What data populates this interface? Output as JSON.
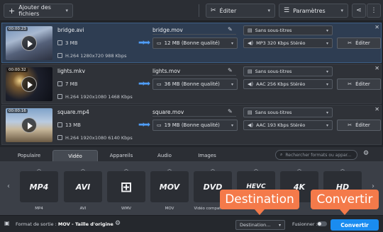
{
  "toolbar": {
    "add_files": "Ajouter des fichiers",
    "edit": "Éditer",
    "settings": "Paramètres"
  },
  "files": [
    {
      "time": "00:00:23",
      "name": "bridge.avi",
      "size": "3 MB",
      "info": "H.264 1280x720 988 Kbps",
      "out_name": "bridge.mov",
      "out_size": "12 MB (Bonne qualité)",
      "subtitles": "Sans sous-titres",
      "audio": "MP3 320 Kbps Stéréo",
      "edit_label": "Éditer"
    },
    {
      "time": "00:00:32",
      "name": "lights.mkv",
      "size": "7 MB",
      "info": "H.264 1920x1080 1468 Kbps",
      "out_name": "lights.mov",
      "out_size": "36 MB (Bonne qualité)",
      "subtitles": "Sans sous-titres",
      "audio": "AAC 256 Kbps Stéréo",
      "edit_label": "Éditer"
    },
    {
      "time": "00:00:16",
      "name": "square.mp4",
      "size": "13 MB",
      "info": "H.264 1920x1080 6140 Kbps",
      "out_name": "square.mov",
      "out_size": "19 MB (Bonne qualité)",
      "subtitles": "Sans sous-titres",
      "audio": "AAC 193 Kbps Stéréo",
      "edit_label": "Éditer"
    }
  ],
  "tabs": [
    "Populaire",
    "Vidéo",
    "Appareils",
    "Audio",
    "Images"
  ],
  "search_placeholder": "Rechercher formats ou appar...",
  "formats": [
    {
      "logo": "MP4",
      "label": "MP4"
    },
    {
      "logo": "AVI",
      "label": "AVI"
    },
    {
      "logo": "⊞",
      "label": "WMV"
    },
    {
      "logo": "MOV",
      "label": "MOV"
    },
    {
      "logo": "DVD",
      "label": "Vidéo compatible..."
    },
    {
      "logo": "HEVC",
      "label": ""
    },
    {
      "logo": "4K",
      "label": ""
    },
    {
      "logo": "HD",
      "label": ""
    }
  ],
  "bottom": {
    "output_label": "Format de sortie :",
    "output_value": "MOV - Taille d'origine",
    "destination": "Destination...",
    "merge": "Fusionner :",
    "convert": "Convertir"
  },
  "callouts": {
    "destination": "Destination",
    "convert": "Convertir"
  },
  "colors": {
    "accent": "#1a8cf0",
    "callout": "#f47a4a"
  }
}
